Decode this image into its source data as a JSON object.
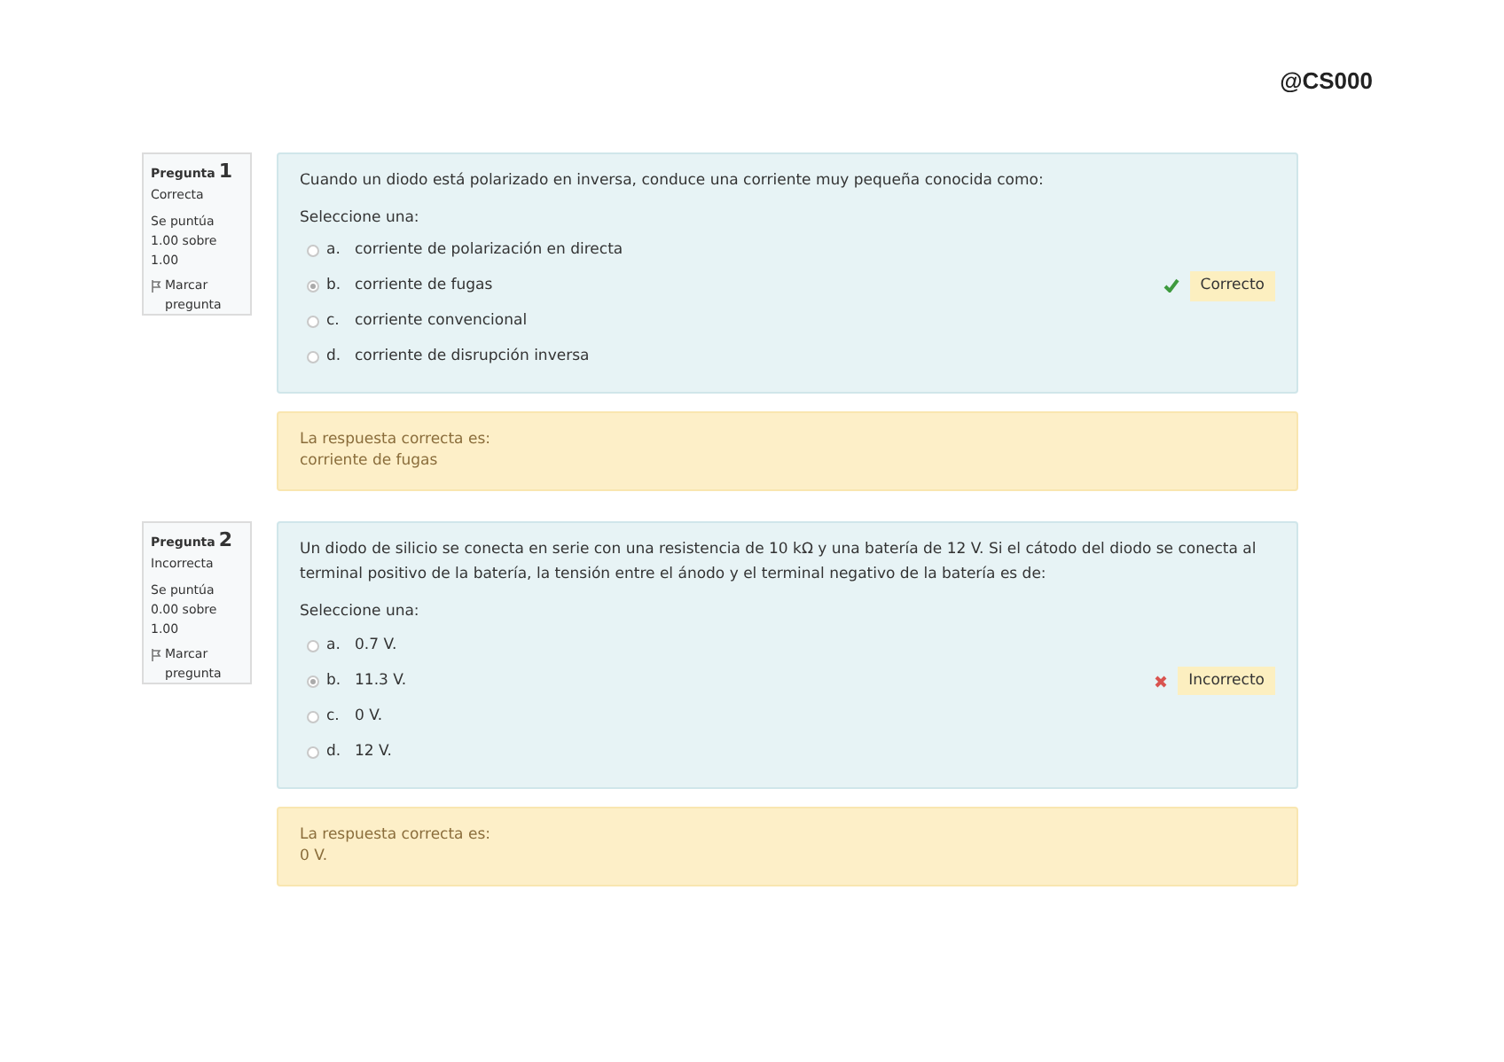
{
  "header": {
    "handle": "@CS000"
  },
  "questions": [
    {
      "label": "Pregunta",
      "number": "1",
      "status": "Correcta",
      "score": "Se puntúa 1.00 sobre 1.00",
      "flag": "Marcar pregunta",
      "text": "Cuando un diodo está polarizado en inversa, conduce una corriente muy pequeña conocida como:",
      "prompt": "Seleccione una:",
      "options": [
        {
          "letter": "a.",
          "text": "corriente de polarización en directa",
          "selected": false
        },
        {
          "letter": "b.",
          "text": "corriente de fugas",
          "selected": true
        },
        {
          "letter": "c.",
          "text": "corriente convencional",
          "selected": false
        },
        {
          "letter": "d.",
          "text": "corriente de disrupción inversa",
          "selected": false
        }
      ],
      "result": {
        "kind": "correct",
        "label": "Correcto"
      },
      "feedback": {
        "title": "La respuesta correcta es:",
        "answer": "corriente de fugas"
      }
    },
    {
      "label": "Pregunta",
      "number": "2",
      "status": "Incorrecta",
      "score": "Se puntúa 0.00 sobre 1.00",
      "flag": "Marcar pregunta",
      "text": "Un diodo de silicio se conecta en serie con una resistencia de 10 kΩ y una batería de 12 V. Si el cátodo del diodo se conecta al terminal positivo de la batería, la tensión entre el ánodo y el terminal negativo de la batería es de:",
      "prompt": "Seleccione una:",
      "options": [
        {
          "letter": "a.",
          "text": "0.7 V.",
          "selected": false
        },
        {
          "letter": "b.",
          "text": "11.3 V.",
          "selected": true
        },
        {
          "letter": "c.",
          "text": "0 V.",
          "selected": false
        },
        {
          "letter": "d.",
          "text": "12 V.",
          "selected": false
        }
      ],
      "result": {
        "kind": "incorrect",
        "label": "Incorrecto"
      },
      "feedback": {
        "title": "La respuesta correcta es:",
        "answer": "0 V."
      }
    }
  ]
}
